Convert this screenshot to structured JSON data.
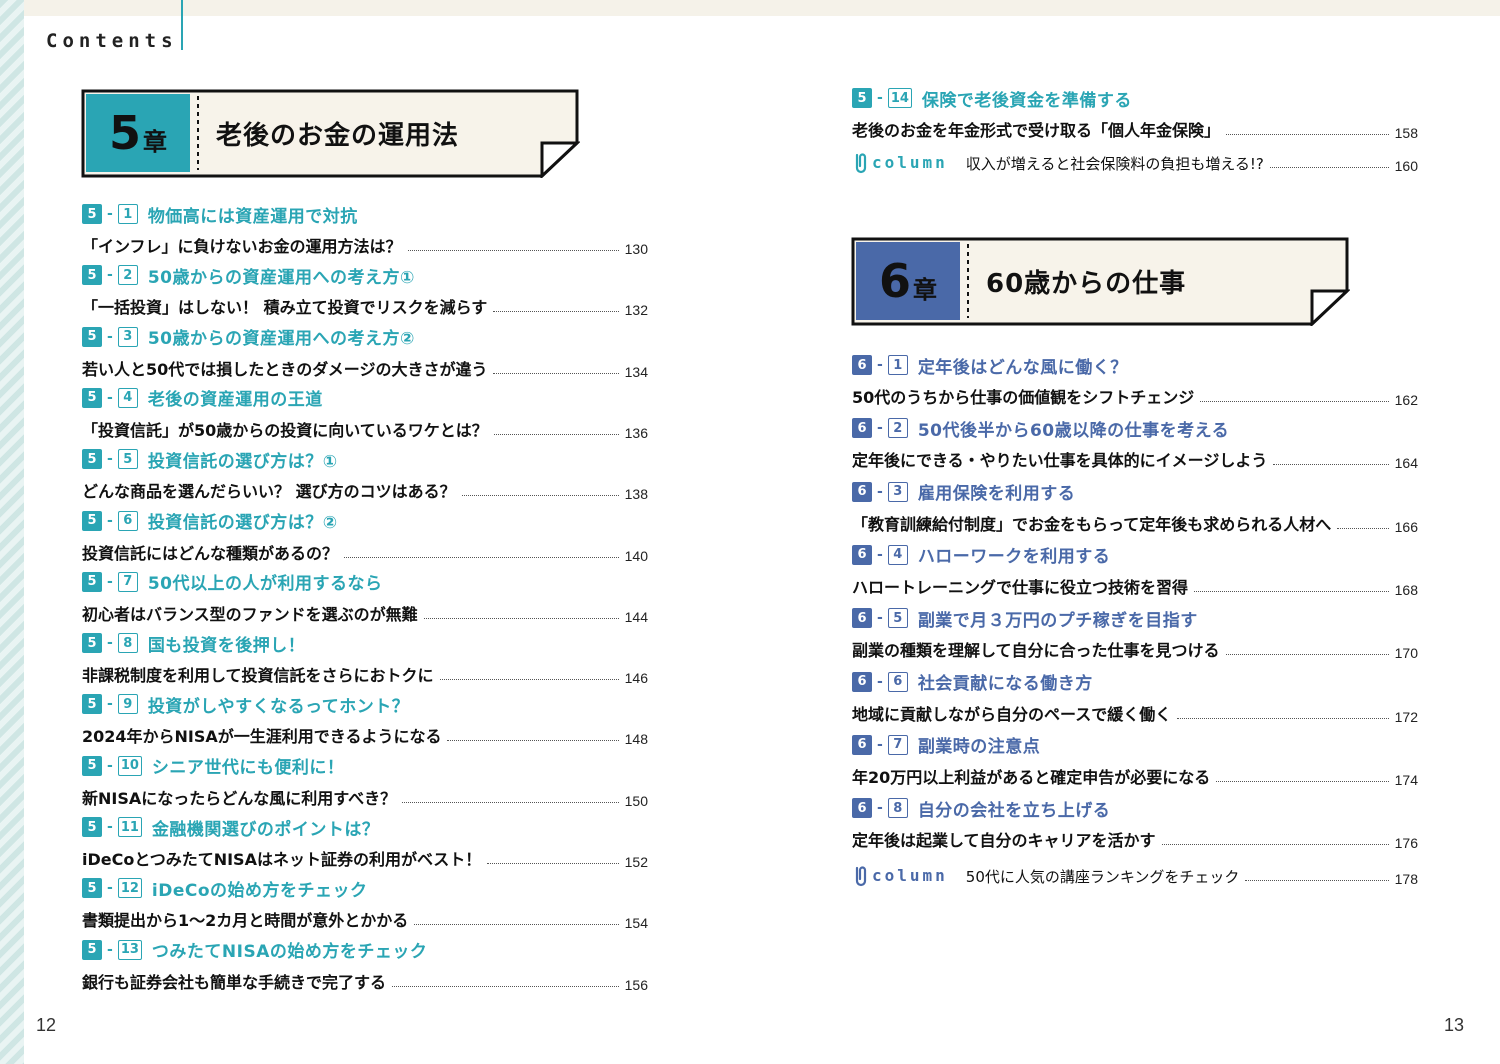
{
  "header": {
    "contents_label": "Contents"
  },
  "pages": {
    "left": "12",
    "right": "13"
  },
  "colors": {
    "teal": "#2aa5b4",
    "blue": "#4a69a8"
  },
  "chapter5": {
    "number": "5",
    "sho": "章",
    "title": "老後のお金の運用法",
    "entries": [
      {
        "ch": "5",
        "n": "1",
        "title": "物価高には資産運用で対抗",
        "desc": "「インフレ」に負けないお金の運用方法は？",
        "page": "130"
      },
      {
        "ch": "5",
        "n": "2",
        "title": "50歳からの資産運用への考え方①",
        "desc": "「一括投資」はしない！ 積み立て投資でリスクを減らす",
        "page": "132"
      },
      {
        "ch": "5",
        "n": "3",
        "title": "50歳からの資産運用への考え方②",
        "desc": "若い人と50代では損したときのダメージの大きさが違う",
        "page": "134"
      },
      {
        "ch": "5",
        "n": "4",
        "title": "老後の資産運用の王道",
        "desc": "「投資信託」が50歳からの投資に向いているワケとは？",
        "page": "136"
      },
      {
        "ch": "5",
        "n": "5",
        "title": "投資信託の選び方は？①",
        "desc": "どんな商品を選んだらいい？ 選び方のコツはある？",
        "page": "138"
      },
      {
        "ch": "5",
        "n": "6",
        "title": "投資信託の選び方は？②",
        "desc": "投資信託にはどんな種類があるの？",
        "page": "140"
      },
      {
        "ch": "5",
        "n": "7",
        "title": "50代以上の人が利用するなら",
        "desc": "初心者はバランス型のファンドを選ぶのが無難",
        "page": "144"
      },
      {
        "ch": "5",
        "n": "8",
        "title": "国も投資を後押し！",
        "desc": "非課税制度を利用して投資信託をさらにおトクに",
        "page": "146"
      },
      {
        "ch": "5",
        "n": "9",
        "title": "投資がしやすくなるってホント？",
        "desc": "2024年からNISAが一生涯利用できるようになる",
        "page": "148"
      },
      {
        "ch": "5",
        "n": "10",
        "title": "シニア世代にも便利に！",
        "desc": "新NISAになったらどんな風に利用すべき？",
        "page": "150"
      },
      {
        "ch": "5",
        "n": "11",
        "title": "金融機関選びのポイントは？",
        "desc": "iDeCoとつみたてNISAはネット証券の利用がベスト！",
        "page": "152"
      },
      {
        "ch": "5",
        "n": "12",
        "title": "iDeCoの始め方をチェック",
        "desc": "書類提出から1〜2カ月と時間が意外とかかる",
        "page": "154"
      },
      {
        "ch": "5",
        "n": "13",
        "title": "つみたてNISAの始め方をチェック",
        "desc": "銀行も証券会社も簡単な手続きで完了する",
        "page": "156"
      },
      {
        "ch": "5",
        "n": "14",
        "title": "保険で老後資金を準備する",
        "desc": "老後のお金を年金形式で受け取る「個人年金保険」",
        "page": "158"
      }
    ],
    "column": {
      "label": "column",
      "desc": "収入が増えると社会保険料の負担も増える!?",
      "page": "160"
    }
  },
  "chapter6": {
    "number": "6",
    "sho": "章",
    "title": "60歳からの仕事",
    "entries": [
      {
        "ch": "6",
        "n": "1",
        "title": "定年後はどんな風に働く？",
        "desc": "50代のうちから仕事の価値観をシフトチェンジ",
        "page": "162"
      },
      {
        "ch": "6",
        "n": "2",
        "title": "50代後半から60歳以降の仕事を考える",
        "desc": "定年後にできる・やりたい仕事を具体的にイメージしよう",
        "page": "164"
      },
      {
        "ch": "6",
        "n": "3",
        "title": "雇用保険を利用する",
        "desc": "「教育訓練給付制度」でお金をもらって定年後も求められる人材へ",
        "page": "166"
      },
      {
        "ch": "6",
        "n": "4",
        "title": "ハローワークを利用する",
        "desc": "ハロートレーニングで仕事に役立つ技術を習得",
        "page": "168"
      },
      {
        "ch": "6",
        "n": "5",
        "title": "副業で月３万円のプチ稼ぎを目指す",
        "desc": "副業の種類を理解して自分に合った仕事を見つける",
        "page": "170"
      },
      {
        "ch": "6",
        "n": "6",
        "title": "社会貢献になる働き方",
        "desc": "地域に貢献しながら自分のペースで緩く働く",
        "page": "172"
      },
      {
        "ch": "6",
        "n": "7",
        "title": "副業時の注意点",
        "desc": "年20万円以上利益があると確定申告が必要になる",
        "page": "174"
      },
      {
        "ch": "6",
        "n": "8",
        "title": "自分の会社を立ち上げる",
        "desc": "定年後は起業して自分のキャリアを活かす",
        "page": "176"
      }
    ],
    "column": {
      "label": "column",
      "desc": "50代に人気の講座ランキングをチェック",
      "page": "178"
    }
  }
}
